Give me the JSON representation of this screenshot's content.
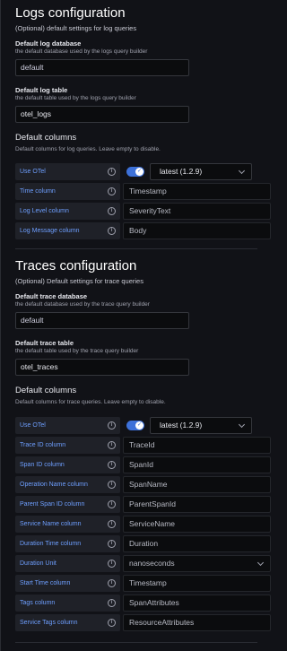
{
  "logs": {
    "title": "Logs configuration",
    "subtitle": "(Optional) default settings for log queries",
    "database": {
      "label": "Default log database",
      "description": "the default database used by the logs query builder",
      "value": "default"
    },
    "table": {
      "label": "Default log table",
      "description": "the default table used by the logs query builder",
      "value": "otel_logs"
    },
    "columns_title": "Default columns",
    "columns_description": "Default columns for log queries. Leave empty to disable.",
    "use_otel": {
      "label": "Use OTel",
      "enabled": true,
      "version": "latest (1.2.9)"
    },
    "rows": [
      {
        "label": "Time column",
        "value": "Timestamp"
      },
      {
        "label": "Log Level column",
        "value": "SeverityText"
      },
      {
        "label": "Log Message column",
        "value": "Body"
      }
    ]
  },
  "traces": {
    "title": "Traces configuration",
    "subtitle": "(Optional) Default settings for trace queries",
    "database": {
      "label": "Default trace database",
      "description": "the default database used by the trace query builder",
      "value": "default"
    },
    "table": {
      "label": "Default trace table",
      "description": "the default table used by the trace query builder",
      "value": "otel_traces"
    },
    "columns_title": "Default columns",
    "columns_description": "Default columns for trace queries. Leave empty to disable.",
    "use_otel": {
      "label": "Use OTel",
      "enabled": true,
      "version": "latest (1.2.9)"
    },
    "rows": [
      {
        "label": "Trace ID column",
        "value": "TraceId"
      },
      {
        "label": "Span ID column",
        "value": "SpanId"
      },
      {
        "label": "Operation Name column",
        "value": "SpanName"
      },
      {
        "label": "Parent Span ID column",
        "value": "ParentSpanId"
      },
      {
        "label": "Service Name column",
        "value": "ServiceName"
      },
      {
        "label": "Duration Time column",
        "value": "Duration"
      },
      {
        "label": "Duration Unit",
        "value": "nanoseconds"
      },
      {
        "label": "Start Time column",
        "value": "Timestamp"
      },
      {
        "label": "Tags column",
        "value": "SpanAttributes"
      },
      {
        "label": "Service Tags column",
        "value": "ResourceAttributes"
      }
    ]
  },
  "info_glyph": "i",
  "check_glyph": "✓",
  "colors": {
    "background": "#111217",
    "label_bg": "#1f2128",
    "label_text": "#6e9fff",
    "toggle_on": "#3d71d9"
  }
}
